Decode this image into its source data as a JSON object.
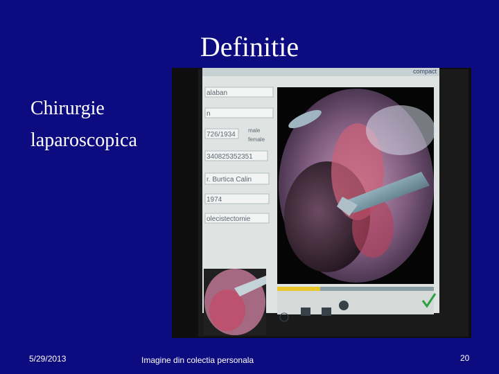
{
  "slide": {
    "title": "Definitie",
    "body_lines": [
      "Chirurgie",
      "laparoscopica"
    ]
  },
  "footer": {
    "date": "5/29/2013",
    "caption": "Imagine din colectia  personala",
    "page_number": "20"
  },
  "photo": {
    "monitor_brand": "compact",
    "form_values": [
      "alaban",
      "n",
      "726/1934",
      "340825352351",
      "r. Burtica Calin",
      "1974",
      "olecistectomie"
    ],
    "sex_options": [
      "male",
      "female"
    ]
  }
}
